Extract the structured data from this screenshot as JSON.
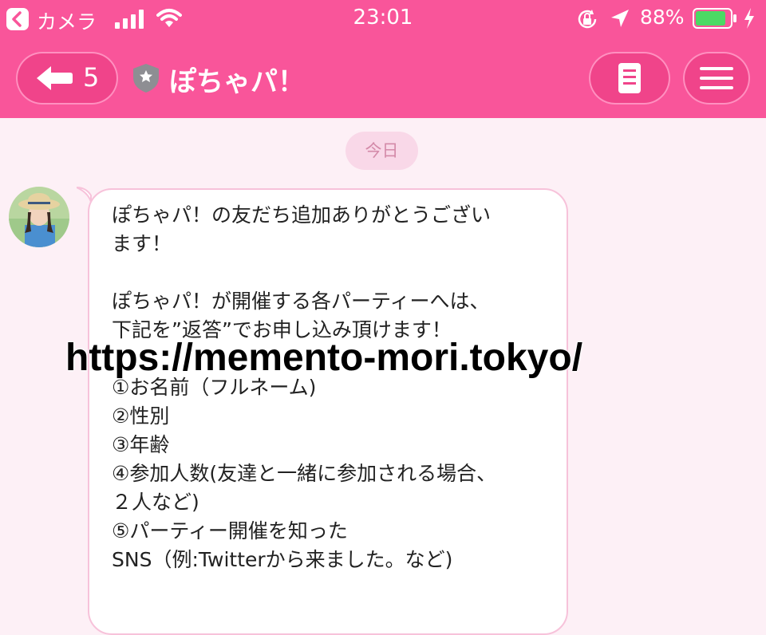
{
  "status_bar": {
    "back_app_label": "カメラ",
    "time": "23:01",
    "battery_percent": "88%",
    "battery_level": 0.88,
    "icons": [
      "back-icon",
      "signal-icon",
      "wifi-icon",
      "rotation-lock-icon",
      "location-icon",
      "battery-icon",
      "charging-icon"
    ]
  },
  "nav": {
    "back_count": "5",
    "title": "ぽちゃパ！",
    "icons": [
      "back-arrow-icon",
      "shield-star-icon",
      "notes-icon",
      "hamburger-menu-icon"
    ]
  },
  "colors": {
    "accent": "#f9559a",
    "background": "#fdf0f6",
    "bubble_border": "#f7c2da",
    "date_pill": "#f9d8e8"
  },
  "chat": {
    "date_label": "今日",
    "message": "ぽちゃパ！の友だち追加ありがとうござい\nます！\n\nぽちゃパ！が開催する各パーティーへは、\n下記を”返答”でお申し込み頂けます！\n\n①お名前（フルネーム)\n②性別\n③年齢\n④参加人数(友達と一緒に参加される場合、\n２人など)\n⑤パーティー開催を知った\nSNS（例:Twitterから来ました。など)"
  },
  "overlay": {
    "url": "https://memento-mori.tokyo/"
  }
}
